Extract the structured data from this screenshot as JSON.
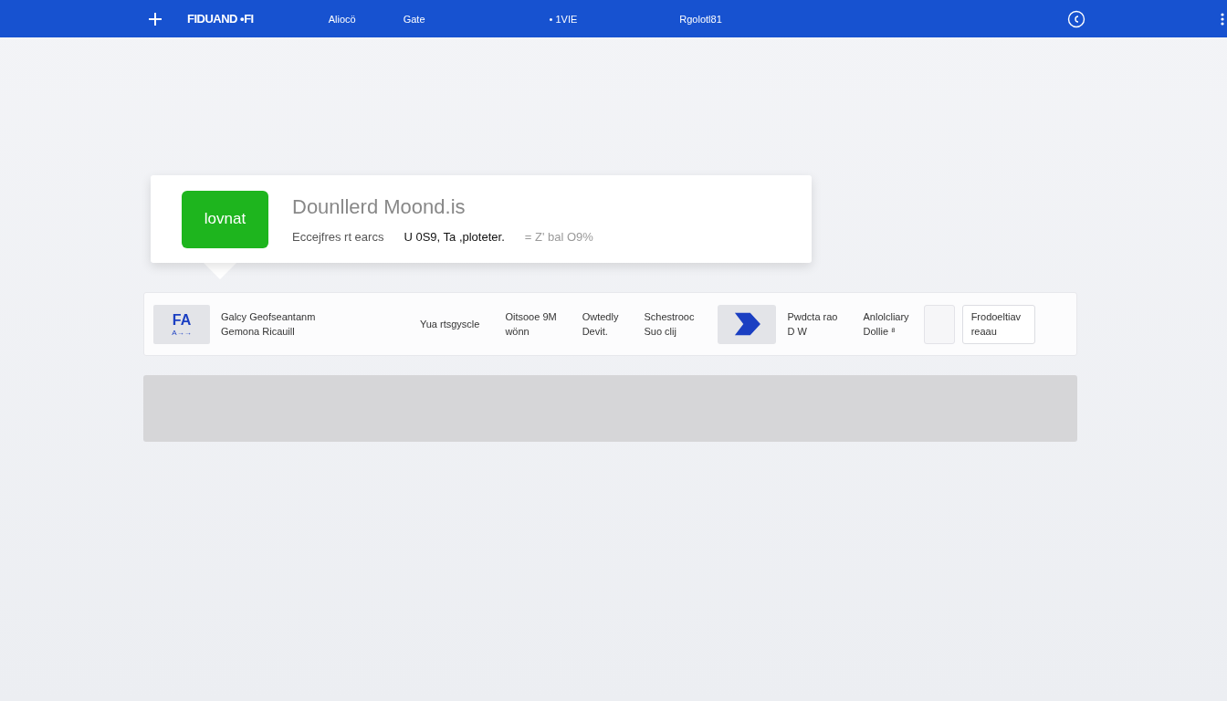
{
  "header": {
    "logo": "FIDUAND •FI",
    "nav": [
      {
        "label": "Aliocö"
      },
      {
        "label": "Gate"
      },
      {
        "label": "• 1VIE"
      },
      {
        "label": "Rgolotl81"
      }
    ]
  },
  "card": {
    "badge": "lovnat",
    "title": "Dounllerd Moond.is",
    "meta": [
      {
        "text": "Eccejfres rt earcs",
        "kind": "muted"
      },
      {
        "text": "U 0S9, Ta ,plotetеr.",
        "kind": "strong"
      },
      {
        "text": "= Z' bal O9%",
        "kind": "faint"
      }
    ]
  },
  "row": [
    {
      "kind": "logo",
      "lines": [
        "FA",
        "A→→"
      ]
    },
    {
      "kind": "text",
      "lines": [
        "Galcy Geofseantanm",
        "Gemona Ricauill"
      ]
    },
    {
      "kind": "text",
      "lines": [
        "Yua rtsgyscle"
      ]
    },
    {
      "kind": "text",
      "lines": [
        "Oitsooe 9M",
        "wönn"
      ]
    },
    {
      "kind": "text",
      "lines": [
        "Owtedly",
        "Devit."
      ]
    },
    {
      "kind": "text",
      "lines": [
        "Schestrooc",
        "Suo clij"
      ]
    },
    {
      "kind": "arrow"
    },
    {
      "kind": "text",
      "lines": [
        "Pwdcta rao",
        "D W"
      ]
    },
    {
      "kind": "text",
      "lines": [
        "Anlolcliary",
        "Dollie ⁸"
      ]
    },
    {
      "kind": "small-button"
    },
    {
      "kind": "button",
      "lines": [
        "Frodoeltiav",
        "reaau"
      ]
    }
  ]
}
